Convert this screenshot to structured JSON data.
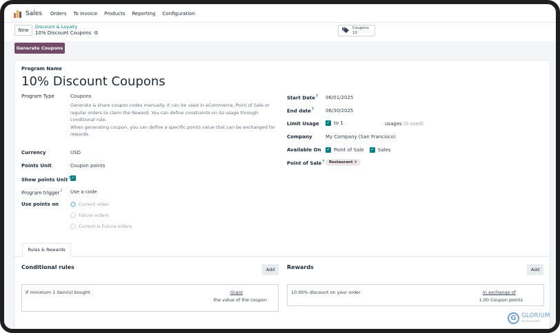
{
  "topnav": {
    "app": "Sales",
    "menu": [
      "Orders",
      "To Invoice",
      "Products",
      "Reporting",
      "Configuration"
    ]
  },
  "control": {
    "new_label": "New",
    "breadcrumb_parent": "Discount & Loyalty",
    "breadcrumb_current": "10% Discount Coupons",
    "smart_button": {
      "label": "Coupons",
      "count": "10"
    }
  },
  "actions": {
    "generate": "Generate Coupons"
  },
  "form": {
    "program_name_label": "Program Name",
    "program_name": "10% Discount Coupons",
    "left": {
      "program_type_label": "Program Type",
      "program_type_value": "Coupons",
      "program_type_desc": [
        "Generate & share coupon codes manually. It can be used in eCommerce, Point of Sale or",
        "regular orders to claim the Reward. You can define constraints on its usage through",
        "conditional rule.",
        "When generating coupon, you can define a specific points value that can be exchanged for",
        "rewards."
      ],
      "currency_label": "Currency",
      "currency_value": "USD",
      "points_unit_label": "Points Unit",
      "points_unit_value": "Coupon points",
      "show_points_label": "Show points Unit",
      "program_trigger_label": "Program trigger",
      "program_trigger_value": "Use a code",
      "use_points_label": "Use points on",
      "use_points_options": [
        "Current order",
        "Future orders",
        "Current & Future orders"
      ]
    },
    "right": {
      "start_date_label": "Start Date",
      "start_date_value": "06/01/2025",
      "end_date_label": "End date",
      "end_date_value": "06/30/2025",
      "limit_usage_label": "Limit Usage",
      "limit_to": "to 1",
      "usages_text": "usages",
      "usages_used": "(0 used)",
      "company_label": "Company",
      "company_value": "My Company (San Francisco)",
      "available_on_label": "Available On",
      "available_pos": "Point of Sale",
      "available_sales": "Sales",
      "pos_label": "Point of Sale",
      "pos_tag": "Restaurant",
      "help_mark": "?"
    }
  },
  "tabs": {
    "rules_rewards": "Rules & Rewards"
  },
  "rules": {
    "title": "Conditional rules",
    "add": "Add",
    "row_left": "If minimum 1 item(s) bought",
    "row_grant": "Grant",
    "row_grant_sub": "the value of the coupon"
  },
  "rewards": {
    "title": "Rewards",
    "add": "Add",
    "row_left": "10.00% discount on your order",
    "row_exchange": "In exchange of",
    "row_exchange_sub": "1.00 Coupon points"
  },
  "watermark": {
    "name": "GLORIUM",
    "tagline": "TECHNOLOGIES"
  },
  "colors": {
    "primary": "#714b67",
    "accent": "#017e84"
  }
}
